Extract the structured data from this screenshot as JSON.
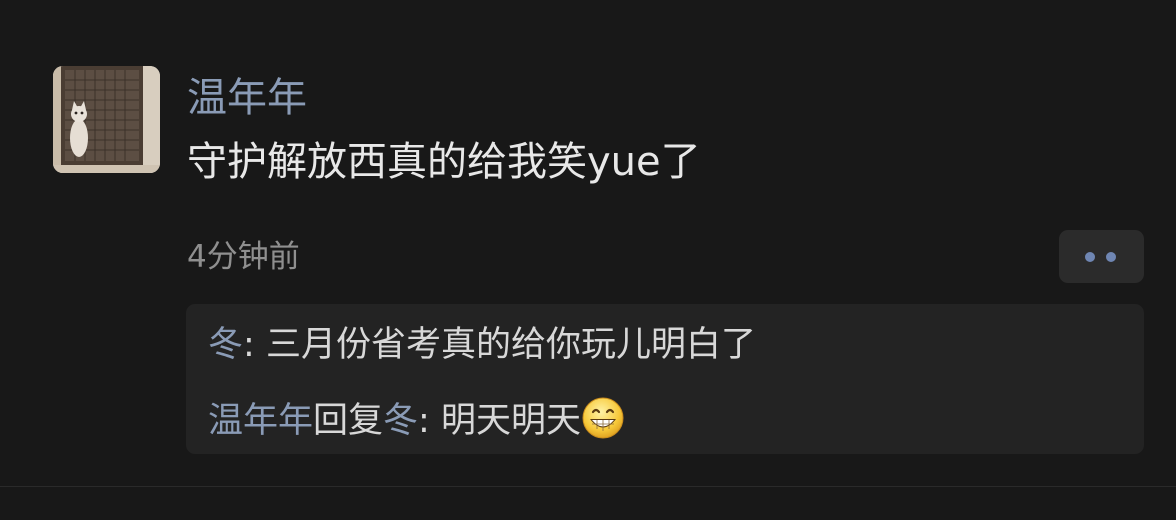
{
  "colors": {
    "background": "#181818",
    "username": "#8a9bb6",
    "text": "#e8e8e8",
    "timestamp": "#8f8f8f",
    "reply_name": "#8a9bb6",
    "reply_text": "#d8d8d8",
    "more_dots": "#6f86b3"
  },
  "comment": {
    "author": "温年年",
    "text": "守护解放西真的给我笑yue了",
    "time": "4分钟前",
    "more_icon": "more-dots-icon",
    "avatar_icon": "cat-in-window-avatar"
  },
  "replies": [
    {
      "author": "冬",
      "separator": ": ",
      "text": "三月份省考真的给你玩儿明白了"
    },
    {
      "author": "温年年",
      "reply_word": "回复",
      "target": "冬",
      "separator": ": ",
      "text": "明天明天",
      "emoji": "grinning-face-emoji"
    }
  ]
}
